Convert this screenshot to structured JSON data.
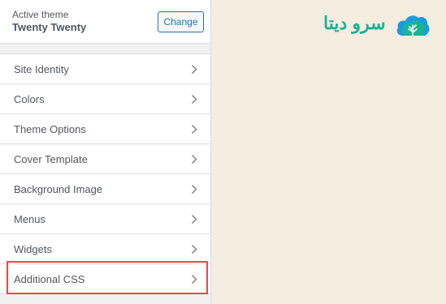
{
  "theme": {
    "label": "Active theme",
    "name": "Twenty Twenty",
    "change_label": "Change"
  },
  "menu": {
    "items": [
      {
        "label": "Site Identity",
        "icon": "chevron-right-icon"
      },
      {
        "label": "Colors",
        "icon": "chevron-right-icon"
      },
      {
        "label": "Theme Options",
        "icon": "chevron-right-icon"
      },
      {
        "label": "Cover Template",
        "icon": "chevron-right-icon"
      },
      {
        "label": "Background Image",
        "icon": "chevron-right-icon"
      },
      {
        "label": "Menus",
        "icon": "chevron-right-icon"
      },
      {
        "label": "Widgets",
        "icon": "chevron-right-icon"
      },
      {
        "label": "Additional CSS",
        "icon": "chevron-right-icon",
        "highlighted": true
      }
    ]
  },
  "logo": {
    "text": "سرو دیتا",
    "icon": "cloud-tree-logo-icon",
    "color": "#1ab394",
    "icon_color": "#1a9be0"
  },
  "colors": {
    "highlight": "#e8484a",
    "accent": "#2271b1",
    "preview_background": "#f4ede0"
  }
}
